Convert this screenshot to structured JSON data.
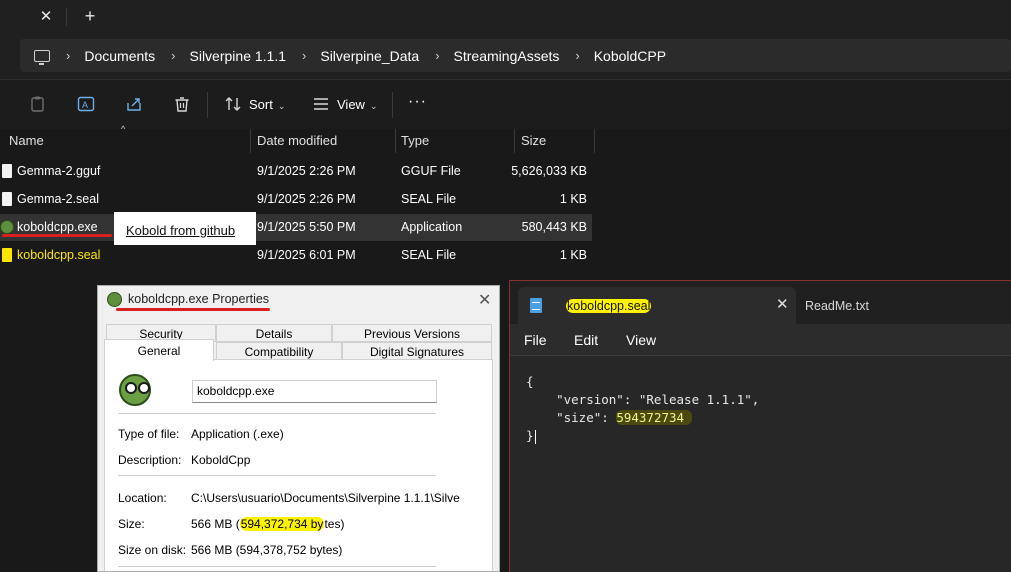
{
  "titlebar": {
    "close_glyph": "✕",
    "new_tab_glyph": "+"
  },
  "breadcrumb": [
    "Documents",
    "Silverpine 1.1.1",
    "Silverpine_Data",
    "StreamingAssets",
    "KoboldCPP"
  ],
  "toolbar": {
    "sort_label": "Sort",
    "view_label": "View",
    "more_glyph": "···"
  },
  "columns": {
    "name": "Name",
    "date": "Date modified",
    "type": "Type",
    "size": "Size"
  },
  "files": [
    {
      "name": "Gemma-2.gguf",
      "date": "9/1/2025 2:26 PM",
      "type": "GGUF File",
      "size": "5,626,033 KB"
    },
    {
      "name": "Gemma-2.seal",
      "date": "9/1/2025 2:26 PM",
      "type": "SEAL File",
      "size": "1 KB"
    },
    {
      "name": "koboldcpp.exe",
      "date": "9/1/2025 5:50 PM",
      "type": "Application",
      "size": "580,443 KB"
    },
    {
      "name": "koboldcpp.seal",
      "date": "9/1/2025 6:01 PM",
      "type": "SEAL File",
      "size": "1 KB"
    }
  ],
  "annotation": "Kobold from github",
  "properties": {
    "title": "koboldcpp.exe Properties",
    "tabs_top": [
      "Security",
      "Details",
      "Previous Versions"
    ],
    "tabs_bottom": [
      "General",
      "Compatibility",
      "Digital Signatures"
    ],
    "filename": "koboldcpp.exe",
    "type_label": "Type of file:",
    "type_value": "Application (.exe)",
    "desc_label": "Description:",
    "desc_value": "KoboldCpp",
    "location_label": "Location:",
    "location_value": "C:\\Users\\usuario\\Documents\\Silverpine 1.1.1\\Silve",
    "size_label": "Size:",
    "size_prefix": "566 MB (",
    "size_highlight": "594,372,734 by",
    "size_suffix": "tes)",
    "disk_label": "Size on disk:",
    "disk_value": "566 MB (594,378,752 bytes)"
  },
  "notepad": {
    "active_tab": "koboldcpp.seal",
    "close_glyph": "✕",
    "other_tab": "ReadMe.txt",
    "menu": [
      "File",
      "Edit",
      "View"
    ],
    "line1": "{",
    "line2": "    \"version\": \"Release 1.1.1\",",
    "line3_prefix": "    \"size\": ",
    "line3_value": "594372734 ",
    "line4": "}"
  },
  "colors": {
    "highlight_yellow": "#fff200",
    "annotation_red": "#d82020",
    "seal_yellow": "#ffe600"
  }
}
